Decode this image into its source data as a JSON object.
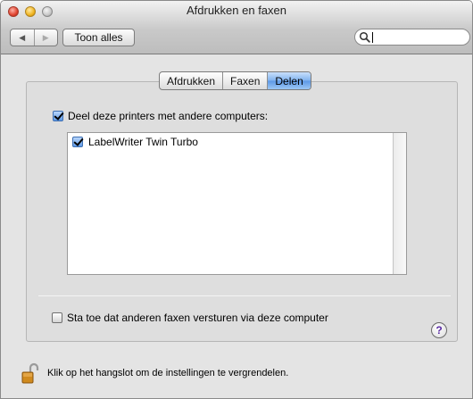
{
  "window": {
    "title": "Afdrukken en faxen"
  },
  "toolbar": {
    "back_glyph": "◀",
    "forward_glyph": "▶",
    "show_all_label": "Toon alles",
    "search": {
      "value": "",
      "placeholder": ""
    }
  },
  "tabs": [
    {
      "label": "Afdrukken",
      "active": false
    },
    {
      "label": "Faxen",
      "active": false
    },
    {
      "label": "Delen",
      "active": true
    }
  ],
  "sharing": {
    "share_printers_label": "Deel deze printers met andere computers:",
    "share_printers_checked": true,
    "printers": [
      {
        "name": "LabelWriter Twin Turbo",
        "checked": true
      }
    ]
  },
  "fax": {
    "allow_fax_label": "Sta toe dat anderen faxen versturen via deze computer",
    "allow_fax_checked": false
  },
  "help": {
    "glyph": "?"
  },
  "lock": {
    "text": "Klik op het hangslot om de instellingen te vergrendelen."
  },
  "colors": {
    "active_tab": "#6ea6ec",
    "help_glyph": "#5b2ca5",
    "lock_body": "#d08a1e"
  },
  "icons": {
    "search": "search-icon",
    "lock": "lock-icon",
    "help": "help-icon"
  }
}
